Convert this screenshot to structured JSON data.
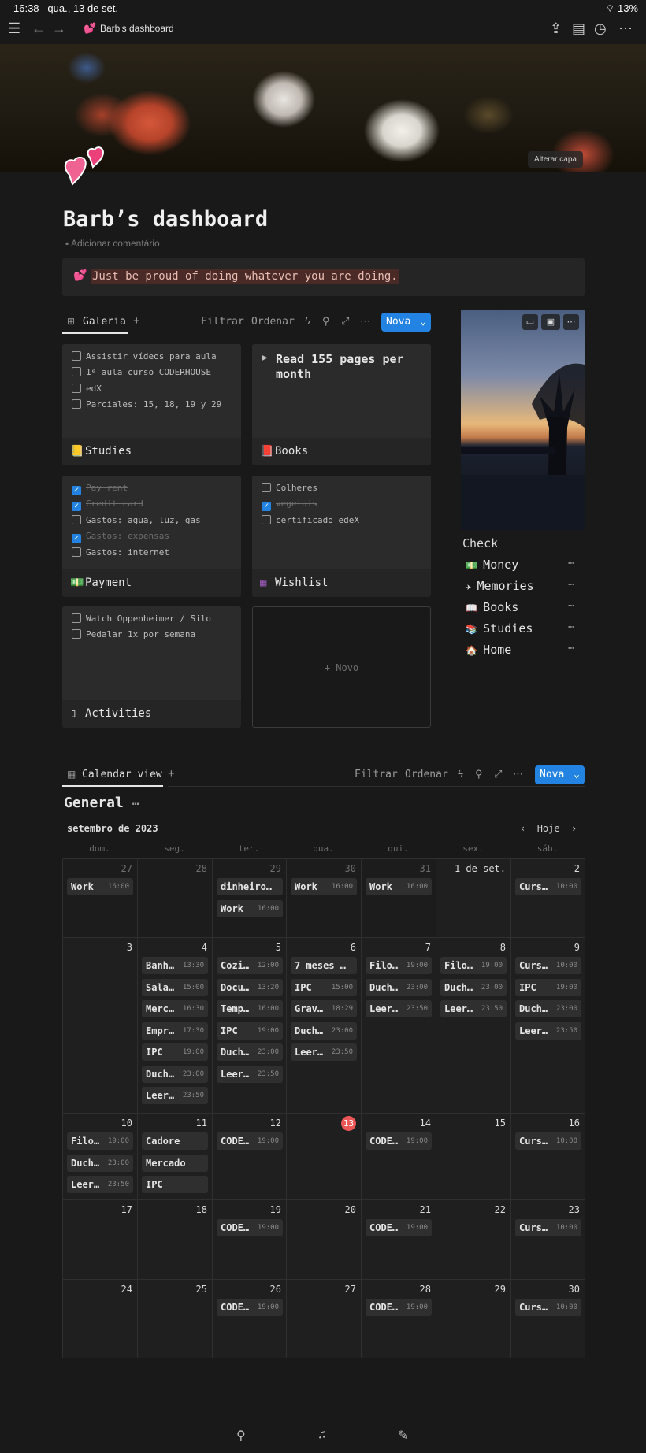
{
  "status": {
    "time": "16:38",
    "date": "qua., 13 de set.",
    "battery": "13%"
  },
  "topbar": {
    "page_title": "Barb's dashboard"
  },
  "cover": {
    "change_label": "Alterar capa"
  },
  "page": {
    "title": "Barb’s dashboard",
    "add_comment": "Adicionar comentário",
    "callout": "Just be proud of doing whatever you are doing."
  },
  "gallery": {
    "tab": "Galeria",
    "filter": "Filtrar",
    "sort": "Ordenar",
    "new": "Nova",
    "new_card": "+ Novo",
    "cards": [
      {
        "name": "Studies",
        "items": [
          {
            "text": "Assistir vídeos para aula",
            "done": false
          },
          {
            "text": "1ª aula curso CODERHOUSE",
            "done": false
          },
          {
            "text": "edX",
            "done": false
          },
          {
            "text": "Parciales: 15, 18, 19 y 29",
            "done": false
          }
        ]
      },
      {
        "name": "Books",
        "heading": "Read 155 pages per month"
      },
      {
        "name": "Payment",
        "items": [
          {
            "text": "Pay rent",
            "done": true
          },
          {
            "text": "Credit card",
            "done": true
          },
          {
            "text": "Gastos: agua, luz, gas",
            "done": false
          },
          {
            "text": "Gastos: expensas",
            "done": true
          },
          {
            "text": "Gastos: internet",
            "done": false
          }
        ]
      },
      {
        "name": "Wishlist",
        "items": [
          {
            "text": "Colheres",
            "done": false
          },
          {
            "text": "vegetais",
            "done": true
          },
          {
            "text": "certificado edeX",
            "done": false
          }
        ]
      },
      {
        "name": "Activities",
        "items": [
          {
            "text": "Watch Oppenheimer / Silo",
            "done": false
          },
          {
            "text": "Pedalar 1x por semana",
            "done": false
          }
        ]
      }
    ]
  },
  "check": {
    "title": "Check",
    "items": [
      "Money",
      "Memories",
      "Books",
      "Studies",
      "Home"
    ]
  },
  "calendar": {
    "tab": "Calendar view",
    "filter": "Filtrar",
    "sort": "Ordenar",
    "new": "Nova",
    "title": "General",
    "month": "setembro de 2023",
    "today_btn": "Hoje",
    "days": [
      "dom.",
      "seg.",
      "ter.",
      "qua.",
      "qui.",
      "sex.",
      "sáb."
    ],
    "weeks": [
      [
        {
          "d": "27",
          "dim": true,
          "ev": [
            [
              "Work",
              "16:00"
            ]
          ]
        },
        {
          "d": "28",
          "dim": true,
          "ev": []
        },
        {
          "d": "29",
          "dim": true,
          "ev": [
            [
              "dinheiro…",
              ""
            ],
            [
              "Work",
              "16:00"
            ]
          ]
        },
        {
          "d": "30",
          "dim": true,
          "ev": [
            [
              "Work",
              "16:00"
            ]
          ]
        },
        {
          "d": "31",
          "dim": true,
          "ev": [
            [
              "Work",
              "16:00"
            ]
          ]
        },
        {
          "d": "1 de set.",
          "ev": []
        },
        {
          "d": "2",
          "ev": [
            [
              "Curs…",
              "10:00"
            ]
          ]
        }
      ],
      [
        {
          "d": "3",
          "ev": []
        },
        {
          "d": "4",
          "ev": [
            [
              "Banh…",
              "13:30"
            ],
            [
              "Sala…",
              "15:00"
            ],
            [
              "Merc…",
              "16:30"
            ],
            [
              "Empr…",
              "17:30"
            ],
            [
              "IPC",
              "19:00"
            ],
            [
              "Duch…",
              "23:00"
            ],
            [
              "Leer…",
              "23:50"
            ]
          ]
        },
        {
          "d": "5",
          "ev": [
            [
              "Cozi…",
              "12:00"
            ],
            [
              "Docu…",
              "13:20"
            ],
            [
              "Temp…",
              "16:00"
            ],
            [
              "IPC",
              "19:00"
            ],
            [
              "Duch…",
              "23:00"
            ],
            [
              "Leer…",
              "23:50"
            ]
          ]
        },
        {
          "d": "6",
          "ev": [
            [
              "7 meses …",
              ""
            ],
            [
              "IPC",
              "15:00"
            ],
            [
              "Grav…",
              "18:29"
            ],
            [
              "Duch…",
              "23:00"
            ],
            [
              "Leer…",
              "23:50"
            ]
          ]
        },
        {
          "d": "7",
          "ev": [
            [
              "Filo…",
              "19:00"
            ],
            [
              "Duch…",
              "23:00"
            ],
            [
              "Leer…",
              "23:50"
            ]
          ]
        },
        {
          "d": "8",
          "ev": [
            [
              "Filo…",
              "19:00"
            ],
            [
              "Duch…",
              "23:00"
            ],
            [
              "Leer…",
              "23:50"
            ]
          ]
        },
        {
          "d": "9",
          "ev": [
            [
              "Curs…",
              "10:00"
            ],
            [
              "IPC",
              "19:00"
            ],
            [
              "Duch…",
              "23:00"
            ],
            [
              "Leer…",
              "23:50"
            ]
          ]
        }
      ],
      [
        {
          "d": "10",
          "ev": [
            [
              "Filo…",
              "19:00"
            ],
            [
              "Duch…",
              "23:00"
            ],
            [
              "Leer…",
              "23:50"
            ]
          ]
        },
        {
          "d": "11",
          "ev": [
            [
              "Cadore",
              ""
            ],
            [
              "Mercado",
              ""
            ],
            [
              "IPC",
              ""
            ]
          ]
        },
        {
          "d": "12",
          "ev": [
            [
              "CODE…",
              "19:00"
            ]
          ]
        },
        {
          "d": "13",
          "today": true,
          "ev": []
        },
        {
          "d": "14",
          "ev": [
            [
              "CODE…",
              "19:00"
            ]
          ]
        },
        {
          "d": "15",
          "ev": []
        },
        {
          "d": "16",
          "ev": [
            [
              "Curs…",
              "10:00"
            ]
          ]
        }
      ],
      [
        {
          "d": "17",
          "ev": []
        },
        {
          "d": "18",
          "ev": []
        },
        {
          "d": "19",
          "ev": [
            [
              "CODE…",
              "19:00"
            ]
          ]
        },
        {
          "d": "20",
          "ev": []
        },
        {
          "d": "21",
          "ev": [
            [
              "CODE…",
              "19:00"
            ]
          ]
        },
        {
          "d": "22",
          "ev": []
        },
        {
          "d": "23",
          "ev": [
            [
              "Curs…",
              "10:00"
            ]
          ]
        }
      ],
      [
        {
          "d": "24",
          "ev": []
        },
        {
          "d": "25",
          "ev": []
        },
        {
          "d": "26",
          "ev": [
            [
              "CODE…",
              "19:00"
            ]
          ]
        },
        {
          "d": "27",
          "ev": []
        },
        {
          "d": "28",
          "ev": [
            [
              "CODE…",
              "19:00"
            ]
          ]
        },
        {
          "d": "29",
          "ev": []
        },
        {
          "d": "30",
          "ev": [
            [
              "Curs…",
              "10:00"
            ]
          ]
        }
      ]
    ]
  }
}
